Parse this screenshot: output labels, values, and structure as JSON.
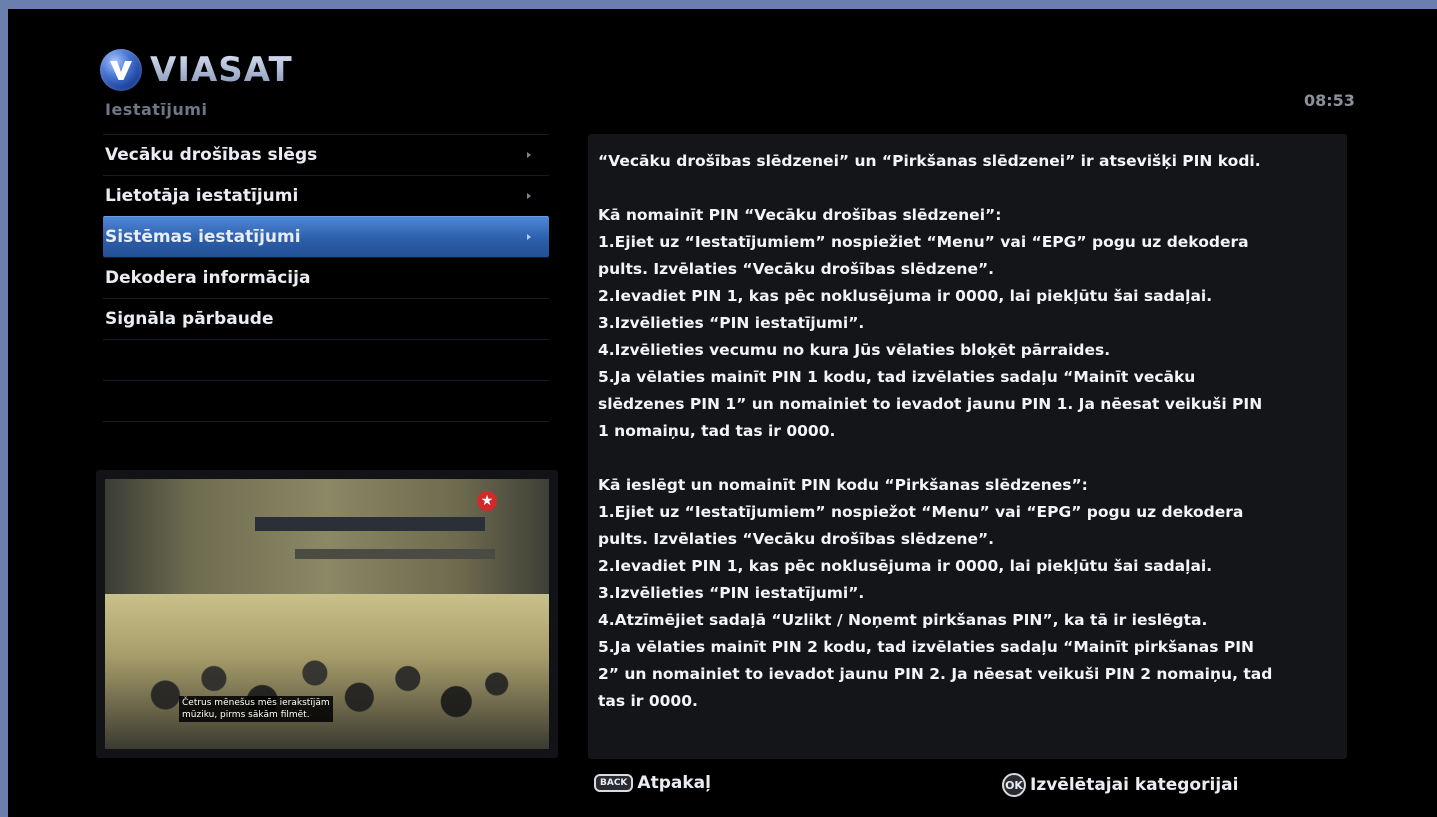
{
  "brand": {
    "name": "VIASAT"
  },
  "header": {
    "section_title": "Iestatījumi",
    "clock": "08:53"
  },
  "menu": {
    "items": [
      {
        "label": "Vecāku drošības slēgs",
        "has_submenu": true,
        "selected": false
      },
      {
        "label": "Lietotāja iestatījumi",
        "has_submenu": true,
        "selected": false
      },
      {
        "label": "Sistēmas iestatījumi",
        "has_submenu": true,
        "selected": true
      },
      {
        "label": "Dekodera informācija",
        "has_submenu": false,
        "selected": false
      },
      {
        "label": "Signāla pārbaude",
        "has_submenu": false,
        "selected": false
      }
    ]
  },
  "preview": {
    "subtitle_line1": "Četrus mēnešus mēs ierakstījām",
    "subtitle_line2": "mūziku, pirms sākām filmēt."
  },
  "info": {
    "intro": "“Vecāku drošības slēdzenei” un “Pirkšanas slēdzenei” ir atsevišķi PIN kodi.",
    "parental_block": "Kā nomainīt PIN “Vecāku drošības slēdzenei”:\n1.Ejiet uz “Iestatījumiem” nospiežiet “Menu” vai “EPG” pogu uz dekodera\npults. Izvēlaties “Vecāku drošības slēdzene”.\n2.Ievadiet PIN 1, kas pēc noklusējuma ir 0000, lai piekļūtu šai sadaļai.\n3.Izvēlieties “PIN iestatījumi”.\n4.Izvēlieties vecumu no kura Jūs vēlaties bloķēt pārraides.\n5.Ja vēlaties mainīt PIN 1 kodu, tad izvēlaties sadaļu “Mainīt vecāku\nslēdzenes PIN 1” un nomainiet to ievadot jaunu PIN 1. Ja nēesat veikuši PIN\n1 nomaiņu, tad tas ir 0000.",
    "purchase_block": "Kā ieslēgt un nomainīt PIN kodu “Pirkšanas slēdzenes”:\n1.Ejiet uz “Iestatījumiem” nospiežot “Menu” vai “EPG” pogu uz dekodera\npults. Izvēlaties “Vecāku drošības slēdzene”.\n2.Ievadiet PIN 1, kas pēc noklusējuma ir 0000, lai piekļūtu šai sadaļai.\n3.Izvēlieties “PIN iestatījumi”.\n4.Atzīmējiet sadaļā “Uzlikt / Noņemt pirkšanas PIN”, ka tā ir ieslēgta.\n5.Ja vēlaties mainīt PIN 2 kodu, tad izvēlaties sadaļu “Mainīt pirkšanas PIN\n2” un nomainiet to ievadot jaunu PIN 2. Ja nēesat veikuši PIN 2 nomaiņu, tad\ntas ir 0000."
  },
  "footer": {
    "back_key": "BACK",
    "back_label": "Atpakaļ",
    "ok_key": "OK",
    "ok_label": "Izvēlētajai kategorijai"
  },
  "colors": {
    "selected_item": "#2b5fab",
    "background": "#000000",
    "panel": "#141518",
    "frame": "#6a7fae"
  }
}
